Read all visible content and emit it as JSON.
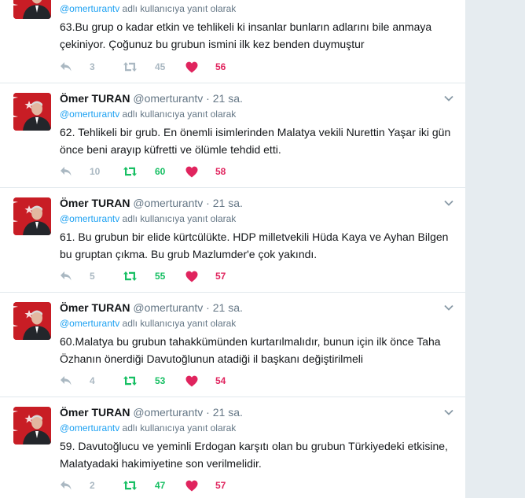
{
  "colors": {
    "link": "#1da1f2",
    "retweeted": "#17bf63",
    "liked": "#e0245e",
    "muted": "#657786"
  },
  "tweets": [
    {
      "name": "",
      "handle": "",
      "sep": "",
      "time": "",
      "reply_mention": "@omerturantv",
      "reply_suffix": " adlı kullanıcıya yanıt olarak",
      "text": "63.Bu grup o kadar etkin ve tehlikeli ki insanlar bunların adlarını bile anmaya çekiniyor. Çoğunuz bu grubun ismini ilk kez benden duymuştur",
      "replies": "3",
      "retweets": "45",
      "retweeted": false,
      "likes": "56"
    },
    {
      "name": "Ömer TURAN",
      "handle": "@omerturantv",
      "sep": "·",
      "time": "21 sa.",
      "reply_mention": "@omerturantv",
      "reply_suffix": " adlı kullanıcıya yanıt olarak",
      "text": "62. Tehlikeli bir grub. En önemli isimlerinden Malatya vekili Nurettin Yaşar iki gün önce beni arayıp küfretti ve ölümle tehdid etti.",
      "replies": "10",
      "retweets": "60",
      "retweeted": true,
      "likes": "58"
    },
    {
      "name": "Ömer TURAN",
      "handle": "@omerturantv",
      "sep": "·",
      "time": "21 sa.",
      "reply_mention": "@omerturantv",
      "reply_suffix": " adlı kullanıcıya yanıt olarak",
      "text": "61. Bu grubun bir elide kürtcülükte. HDP milletvekili Hüda Kaya ve Ayhan Bilgen bu gruptan çıkma. Bu grub Mazlumder'e çok yakındı.",
      "replies": "5",
      "retweets": "55",
      "retweeted": true,
      "likes": "57"
    },
    {
      "name": "Ömer TURAN",
      "handle": "@omerturantv",
      "sep": "·",
      "time": "21 sa.",
      "reply_mention": "@omerturantv",
      "reply_suffix": " adlı kullanıcıya yanıt olarak",
      "text": "60.Malatya bu grubun tahakkümünden kurtarılmalıdır, bunun için ilk önce Taha Özhanın önerdiği Davutoğlunun atadiği il başkanı değiştirilmeli",
      "replies": "4",
      "retweets": "53",
      "retweeted": true,
      "likes": "54"
    },
    {
      "name": "Ömer TURAN",
      "handle": "@omerturantv",
      "sep": "·",
      "time": "21 sa.",
      "reply_mention": "@omerturantv",
      "reply_suffix": " adlı kullanıcıya yanıt olarak",
      "text": "59. Davutoğlucu ve yeminli Erdogan karşıtı olan bu grubun Türkiyedeki etkisine, Malatyadaki hakimiyetine son verilmelidir.",
      "replies": "2",
      "retweets": "47",
      "retweeted": true,
      "likes": "57"
    }
  ]
}
